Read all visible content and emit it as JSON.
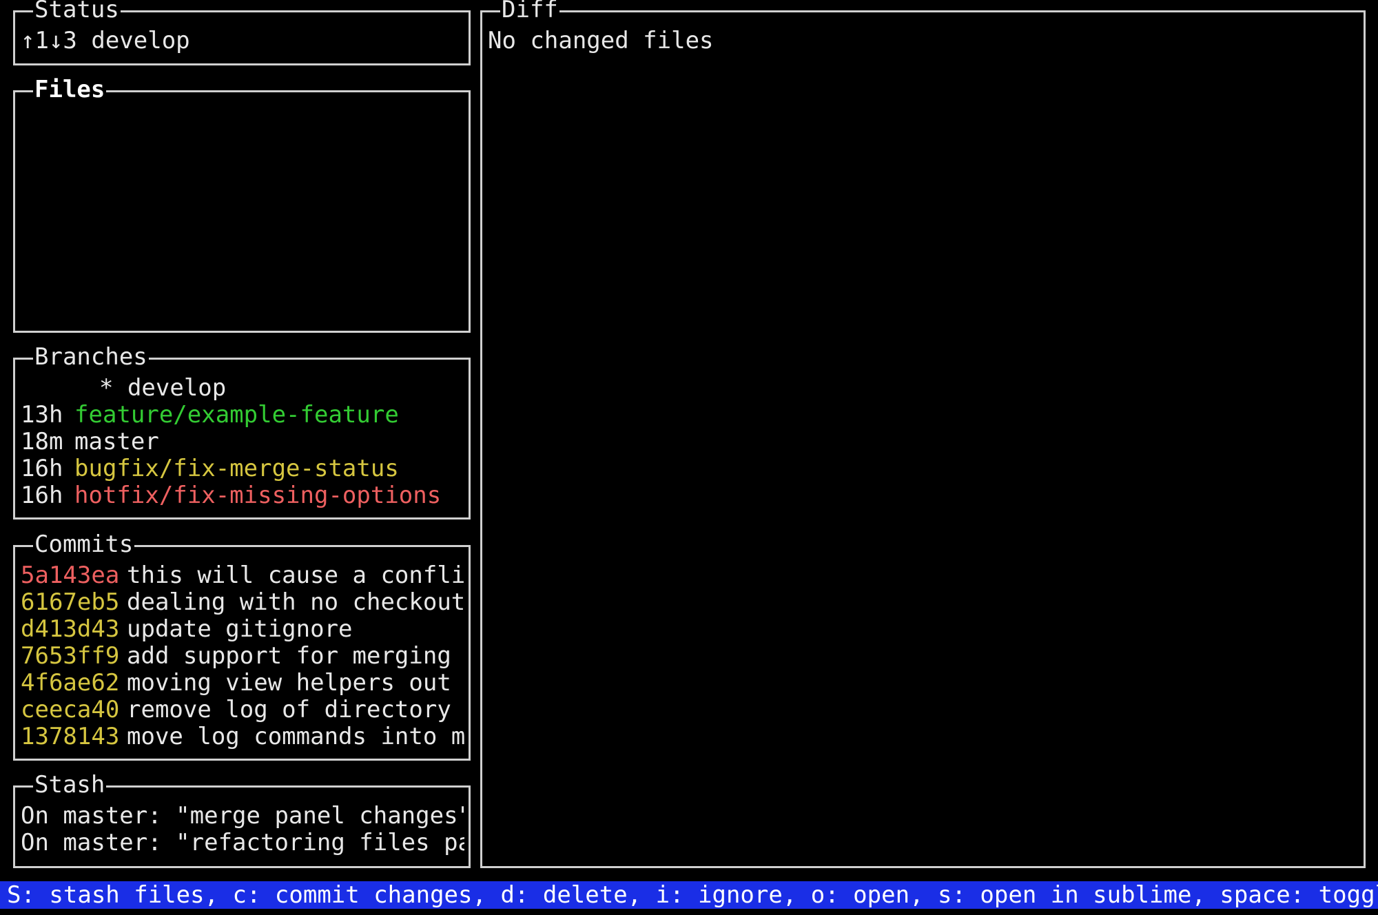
{
  "colors": {
    "green": "#33cc33",
    "yellow": "#d6c640",
    "red": "#ee6060",
    "default": "#e8e8e8",
    "options_bar_bg": "#1a2ee6"
  },
  "status": {
    "title": "Status",
    "text": "↑1↓3 develop"
  },
  "files": {
    "title": "Files",
    "items": []
  },
  "branches": {
    "title": "Branches",
    "items": [
      {
        "age": "",
        "name": "* develop",
        "color": "default"
      },
      {
        "age": "13h",
        "name": "feature/example-feature",
        "color": "green"
      },
      {
        "age": "18m",
        "name": "master",
        "color": "default"
      },
      {
        "age": "16h",
        "name": "bugfix/fix-merge-status",
        "color": "yellow"
      },
      {
        "age": "16h",
        "name": "hotfix/fix-missing-options",
        "color": "red"
      }
    ]
  },
  "commits": {
    "title": "Commits",
    "items": [
      {
        "sha": "5a143ea",
        "message": "this will cause a conflic",
        "color": "red"
      },
      {
        "sha": "6167eb5",
        "message": "dealing with no checkouts",
        "color": "yellow"
      },
      {
        "sha": "d413d43",
        "message": "update gitignore",
        "color": "yellow"
      },
      {
        "sha": "7653ff9",
        "message": "add support for merging",
        "color": "yellow"
      },
      {
        "sha": "4f6ae62",
        "message": "moving view helpers out o",
        "color": "yellow"
      },
      {
        "sha": "ceeca40",
        "message": "remove log of directory",
        "color": "yellow"
      },
      {
        "sha": "1378143",
        "message": "move log commands into ma",
        "color": "yellow"
      }
    ]
  },
  "stash": {
    "title": "Stash",
    "items": [
      "On master: \"merge panel changes\"",
      "On master: \"refactoring files pan"
    ]
  },
  "diff": {
    "title": "Diff",
    "text": "No changed files"
  },
  "options_bar": {
    "text": "S: stash files, c: commit changes, d: delete, i: ignore, o: open, s: open in sublime, space: toggle st"
  }
}
